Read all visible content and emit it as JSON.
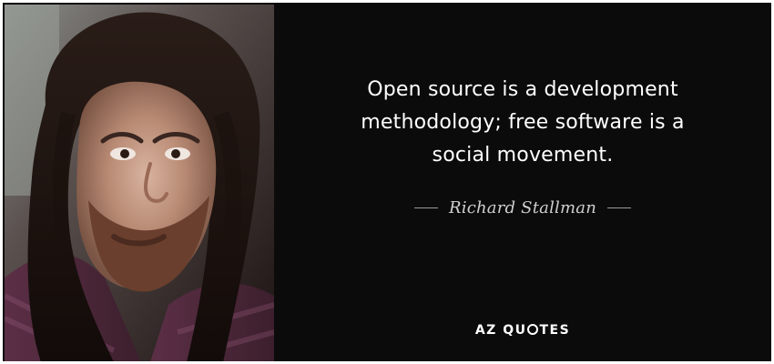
{
  "quote": {
    "text": "Open source is a development methodology; free software is a social movement.",
    "author": "Richard Stallman"
  },
  "branding": {
    "name_prefix": "AZ QU",
    "name_suffix": "TES"
  },
  "colors": {
    "panel_bg": "#0b0b0b",
    "text": "#ffffff",
    "author": "#cfcfcf",
    "rule": "#9b9b9b"
  },
  "icons": {
    "brand_o": "brand-o-mark-icon"
  }
}
